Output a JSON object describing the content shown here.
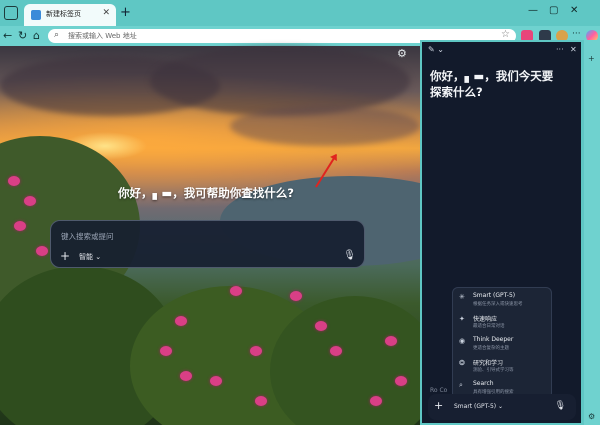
{
  "browser": {
    "tab_title": "新建标签页",
    "tab_close": "✕",
    "new_tab": "+",
    "win_min": "—",
    "win_max": "▢",
    "win_close": "✕",
    "back": "←",
    "refresh": "↻",
    "home": "⌂",
    "address_placeholder": "搜索或输入 Web 地址",
    "address_icon": "⌕",
    "favorite": "☆",
    "more": "···"
  },
  "page": {
    "settings_icon": "⚙",
    "greeting": "你好，▖▬，我可帮助你查找什么?",
    "input_placeholder": "键入搜索或提问",
    "plus": "+",
    "mode": "智能 ⌄",
    "mic": "🎙"
  },
  "panel": {
    "edit_icon": "✎ ⌄",
    "more_icon": "···",
    "close_icon": "✕",
    "greeting": "你好，▖▬，我们今天要探索什么?",
    "menu_items": [
      {
        "icon": "✳",
        "title": "Smart (GPT-5)",
        "desc": "根据任务深入或快速思考"
      },
      {
        "icon": "✦",
        "title": "快速响应",
        "desc": "最适合日常对话"
      },
      {
        "icon": "◉",
        "title": "Think Deeper",
        "desc": "更适合复杂的主题"
      },
      {
        "icon": "❂",
        "title": "研究和学习",
        "desc": "测验、引导式学习等"
      },
      {
        "icon": "⌕",
        "title": "Search",
        "desc": "具有增强引用的搜索"
      }
    ],
    "input_placeholder": "Ro Co",
    "plus": "+",
    "mode": "Smart (GPT-5) ⌄",
    "mic": "🎙"
  },
  "rail": {
    "add": "+",
    "settings": "⚙"
  }
}
